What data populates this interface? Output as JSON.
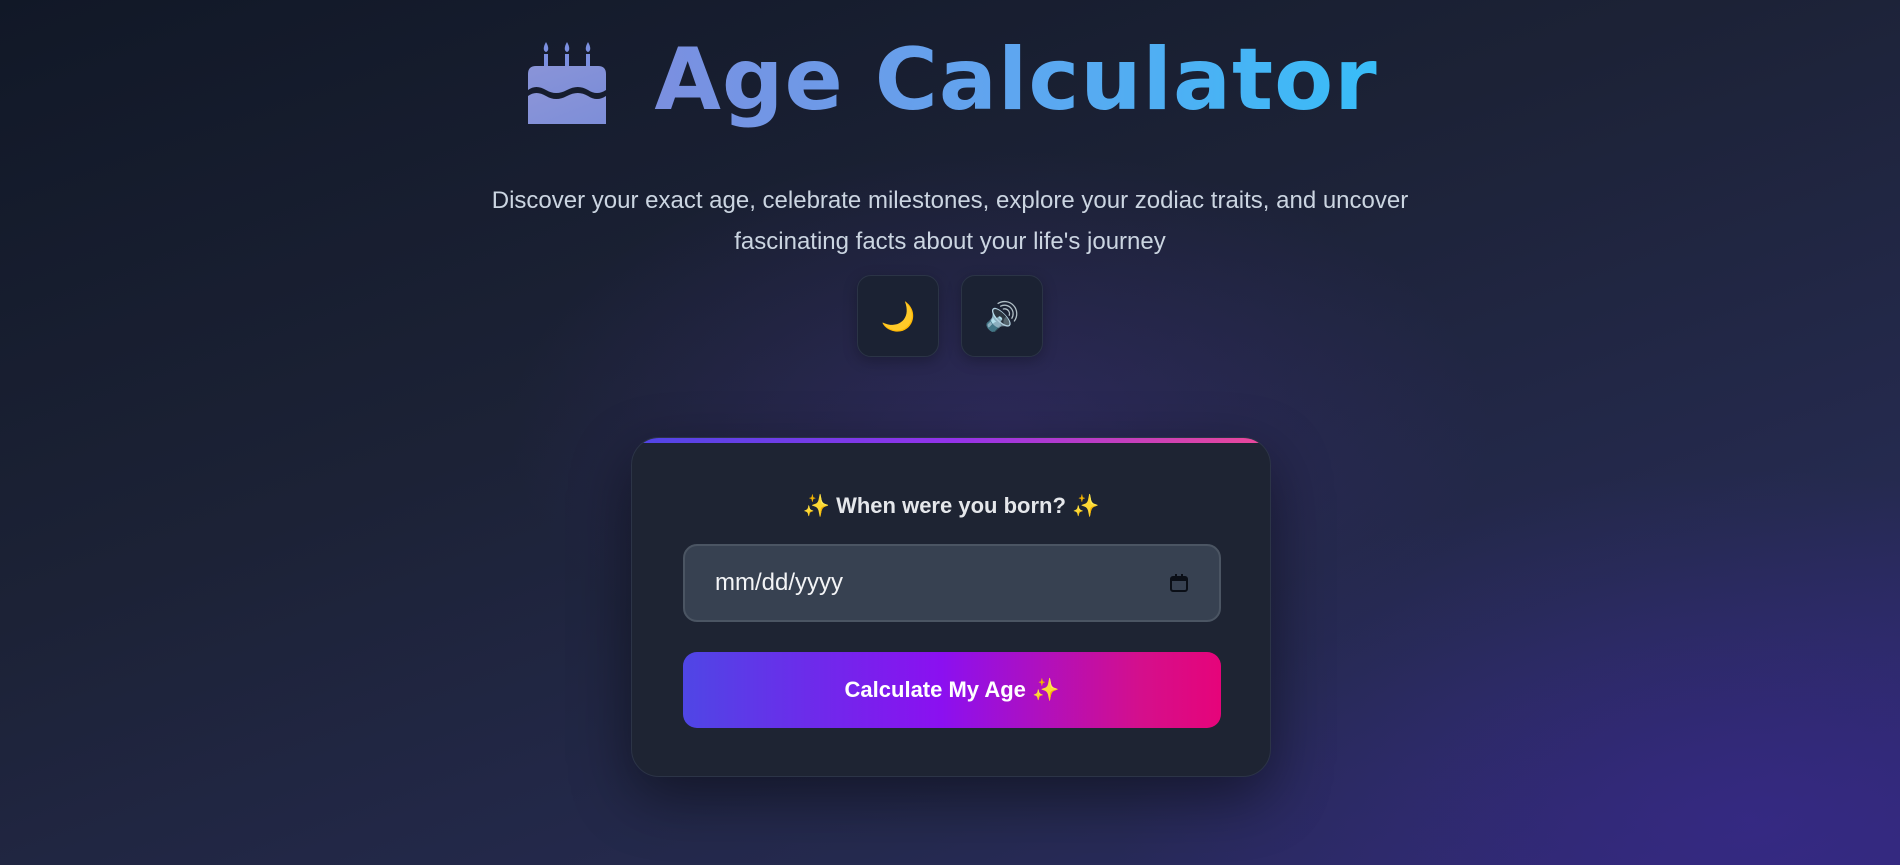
{
  "header": {
    "icon": "birthday-cake-icon",
    "title": "Age Calculator",
    "subtitle_line1": "Discover your exact age, celebrate milestones, explore your zodiac traits, and uncover",
    "subtitle_line2": "fascinating facts about your life's journey"
  },
  "controls": {
    "theme_toggle_icon": "🌙",
    "sound_toggle_icon": "🔊"
  },
  "form": {
    "label_prefix": "✨",
    "label_text": "When were you born?",
    "label_suffix": "✨",
    "date_placeholder": "mm/dd/yyyy",
    "submit_label": "Calculate My Age",
    "submit_icon": "✨"
  },
  "colors": {
    "title_gradient_start": "#7b8fe0",
    "title_gradient_end": "#38bdf8",
    "button_gradient_start": "#4f46e5",
    "button_gradient_mid": "#8b10f0",
    "button_gradient_end": "#e6047a",
    "card_background": "#1e2433"
  }
}
